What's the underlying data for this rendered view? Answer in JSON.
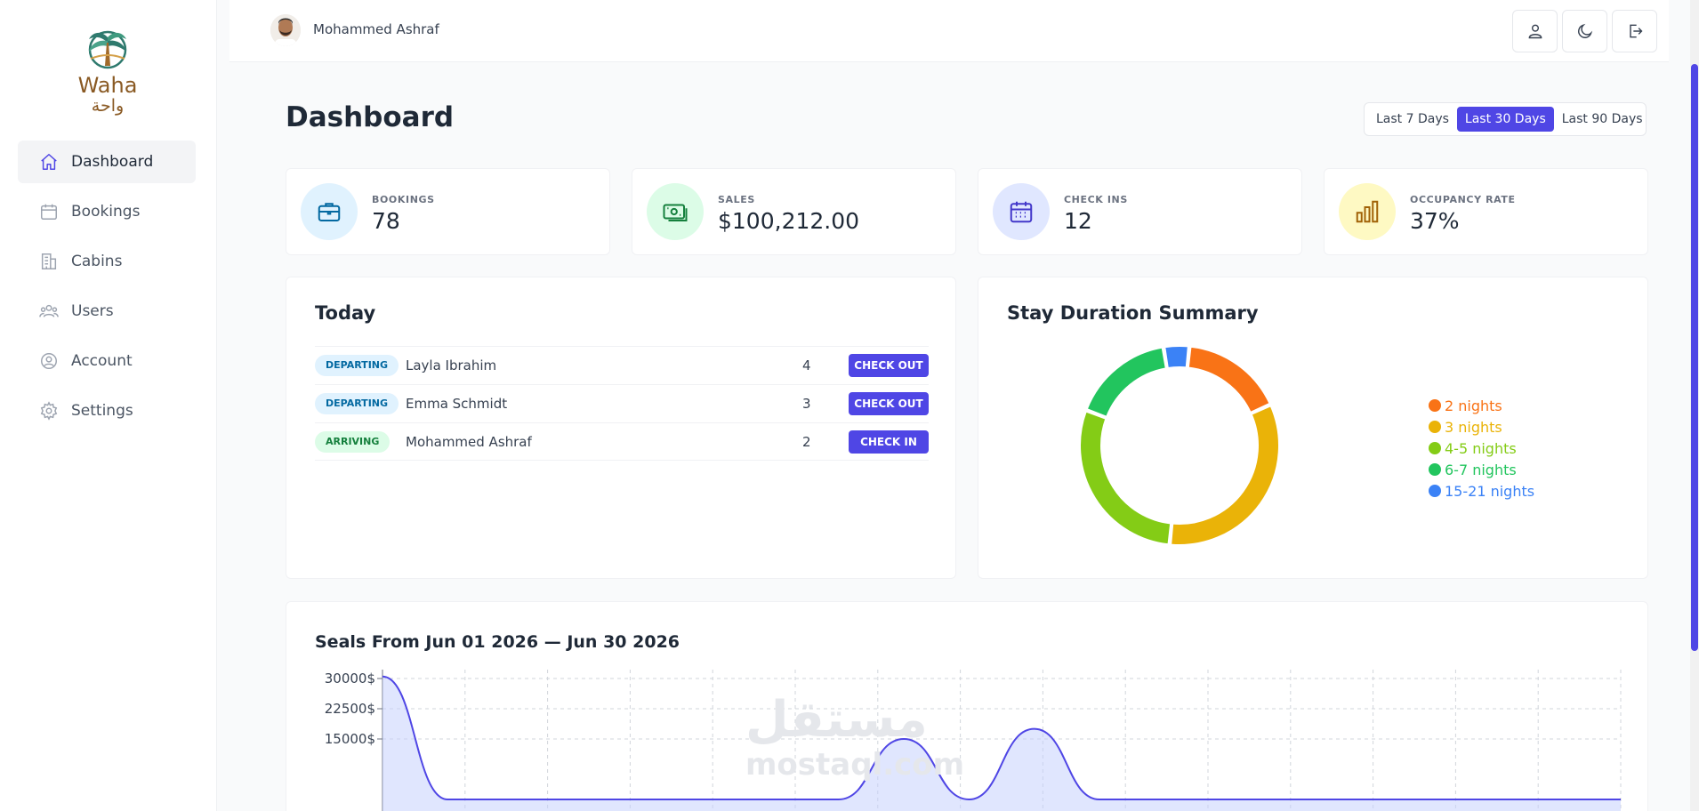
{
  "brand": {
    "name_en": "Waha",
    "name_ar": "واحة"
  },
  "sidebar": {
    "items": [
      {
        "label": "Dashboard",
        "icon": "home-icon",
        "active": true
      },
      {
        "label": "Bookings",
        "icon": "calendar-icon"
      },
      {
        "label": "Cabins",
        "icon": "building-icon"
      },
      {
        "label": "Users",
        "icon": "users-icon"
      },
      {
        "label": "Account",
        "icon": "user-circle-icon"
      },
      {
        "label": "Settings",
        "icon": "gear-icon"
      }
    ]
  },
  "header": {
    "user_name": "Mohammed Ashraf",
    "buttons": [
      "user-icon",
      "moon-icon",
      "logout-icon"
    ]
  },
  "page": {
    "title": "Dashboard",
    "filters": [
      "Last 7 Days",
      "Last 30 Days",
      "Last 90 Days"
    ],
    "active_filter": "Last 30 Days"
  },
  "stats": [
    {
      "label": "BOOKINGS",
      "value": "78",
      "icon": "briefcase-icon",
      "bg": "#e0f2fe",
      "color": "#0369a1"
    },
    {
      "label": "SALES",
      "value": "$100,212.00",
      "icon": "banknote-icon",
      "bg": "#dcfce7",
      "color": "#15803d"
    },
    {
      "label": "CHECK INS",
      "value": "12",
      "icon": "calendar-icon",
      "bg": "#e0e7ff",
      "color": "#4338ca"
    },
    {
      "label": "OCCUPANCY RATE",
      "value": "37%",
      "icon": "bar-chart-icon",
      "bg": "#fef9c3",
      "color": "#a16207"
    }
  ],
  "today": {
    "title": "Today",
    "rows": [
      {
        "status": "DEPARTING",
        "guest": "Layla Ibrahim",
        "nights": "4",
        "action": "CHECK OUT"
      },
      {
        "status": "DEPARTING",
        "guest": "Emma Schmidt",
        "nights": "3",
        "action": "CHECK OUT"
      },
      {
        "status": "ARRIVING",
        "guest": "Mohammed Ashraf",
        "nights": "2",
        "action": "CHECK IN"
      }
    ]
  },
  "stay_duration": {
    "title": "Stay Duration Summary"
  },
  "sales_chart": {
    "title": "Seals From Jun 01 2026 — Jun 30 2026"
  },
  "watermark": {
    "ar": "مستقل",
    "en": "mostaql.com"
  },
  "colors": {
    "accent": "#4f46e5"
  },
  "chart_data": [
    {
      "type": "pie",
      "categories": [
        "2 nights",
        "3 nights",
        "4-5 nights",
        "6-7 nights",
        "15-21 nights"
      ],
      "values": [
        4,
        8,
        7,
        4,
        1
      ],
      "colors": [
        "#f97316",
        "#eab308",
        "#84cc16",
        "#22c55e",
        "#3b82f6"
      ],
      "legend": "right"
    },
    {
      "type": "area",
      "ytick_labels": [
        "30000$",
        "22500$",
        "15000$"
      ],
      "yticks": [
        30000,
        22500,
        15000
      ],
      "ylim": [
        0,
        31000
      ],
      "series": [
        {
          "x": [
            1,
            2,
            3,
            4,
            5,
            6,
            7,
            8,
            9,
            10,
            11,
            12,
            13,
            14,
            15,
            16,
            17,
            18,
            19,
            20
          ],
          "y": [
            30500,
            0,
            0,
            0,
            0,
            0,
            0,
            0,
            15000,
            0,
            17500,
            0,
            0,
            0,
            0,
            0,
            0,
            0,
            0,
            0
          ]
        }
      ],
      "grid": true
    }
  ]
}
